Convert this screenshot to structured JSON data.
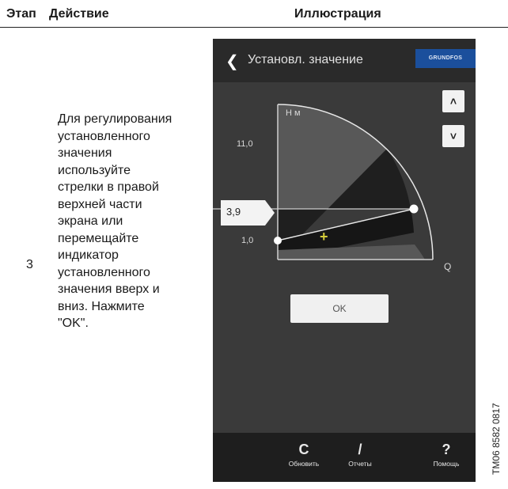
{
  "header": {
    "step": "Этап",
    "action": "Действие",
    "illustration": "Иллюстрация"
  },
  "row": {
    "step_number": "3",
    "action_text": "Для регулирования установленного значения используйте стрелки в правой верхней части экрана или перемещайте индикатор установленного значения вверх и вниз. Нажмите \"OK\"."
  },
  "screen": {
    "title": "Установл. значение",
    "brand": "GRUNDFOS",
    "back_icon": "chevron-left-icon",
    "up_icon": "chevron-up-icon",
    "down_icon": "chevron-down-icon",
    "chart": {
      "y_axis_label": "Н м",
      "x_axis_label": "Q",
      "max_label": "11,0",
      "min_label": "1,0",
      "setpoint_label": "3,9",
      "setpoint": 3.9
    },
    "ok_label": "OK",
    "bottom": [
      {
        "icon": "refresh-icon",
        "label": "Обновить"
      },
      {
        "icon": "pencil-icon",
        "label": "Отчеты"
      },
      {
        "icon": "question-icon",
        "label": "Помощь"
      }
    ],
    "colors": {
      "background": "#3a3a3a",
      "brand": "#1b4f9c",
      "accent_plus": "#d4cc3a"
    }
  },
  "figure_id": "TM06 8582 0817"
}
